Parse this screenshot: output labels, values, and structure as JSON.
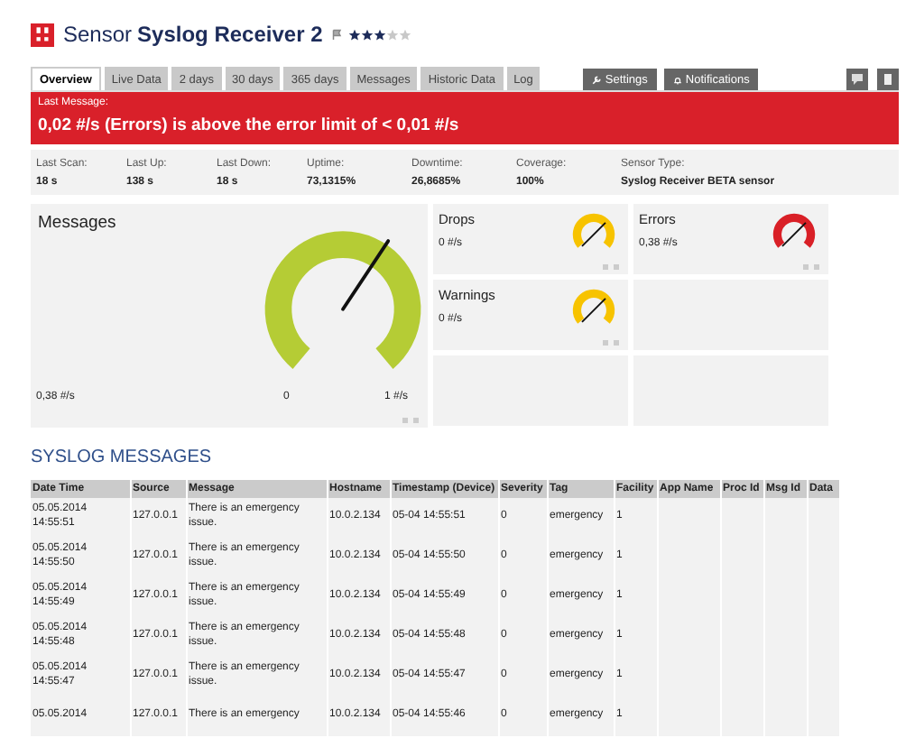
{
  "header": {
    "prefix": "Sensor",
    "title": "Syslog Receiver 2",
    "stars": 3
  },
  "tabs": [
    {
      "label": "Overview",
      "selected": true
    },
    {
      "label": "Live Data",
      "selected": false
    },
    {
      "label": "2 days",
      "selected": false
    },
    {
      "label": "30 days",
      "selected": false
    },
    {
      "label": "365 days",
      "selected": false
    },
    {
      "label": "Messages",
      "selected": false
    },
    {
      "label": "Historic Data",
      "selected": false
    },
    {
      "label": "Log",
      "selected": false
    }
  ],
  "actions": [
    {
      "label": "Settings",
      "kind": "settings"
    },
    {
      "label": "Notifications",
      "kind": "notifications"
    }
  ],
  "alert": {
    "label": "Last Message:",
    "message": "0,02 #/s (Errors) is above the error limit of < 0,01 #/s"
  },
  "stats": [
    {
      "label": "Last Scan:",
      "value": "18 s"
    },
    {
      "label": "Last Up:",
      "value": "138 s"
    },
    {
      "label": "Last Down:",
      "value": "18 s"
    },
    {
      "label": "Uptime:",
      "value": "73,1315%"
    },
    {
      "label": "Downtime:",
      "value": "26,8685%"
    },
    {
      "label": "Coverage:",
      "value": "100%"
    },
    {
      "label": "Sensor Type:",
      "value": "Syslog Receiver BETA sensor"
    }
  ],
  "main_gauge": {
    "title": "Messages",
    "value": "0,38 #/s",
    "min": "0",
    "max": "1 #/s",
    "level": 0.62,
    "color": "#b5cc35"
  },
  "small_gauges": [
    {
      "title": "Drops",
      "value": "0 #/s",
      "color": "#f7c300"
    },
    {
      "title": "Errors",
      "value": "0,38 #/s",
      "color": "#d92027"
    },
    {
      "title": "Warnings",
      "value": "0 #/s",
      "color": "#f7c300"
    }
  ],
  "syslog": {
    "title": "SYSLOG MESSAGES",
    "columns": [
      "Date Time",
      "Source",
      "Message",
      "Hostname",
      "Timestamp (Device)",
      "Severity",
      "Tag",
      "Facility",
      "App Name",
      "Proc Id",
      "Msg Id",
      "Data"
    ],
    "rows": [
      [
        "05.05.2014 14:55:51",
        "127.0.0.1",
        "There is an emergency issue.",
        "10.0.2.134",
        "05-04 14:55:51",
        "0",
        "emergency",
        "1"
      ],
      [
        "05.05.2014 14:55:50",
        "127.0.0.1",
        "There is an emergency issue.",
        "10.0.2.134",
        "05-04 14:55:50",
        "0",
        "emergency",
        "1"
      ],
      [
        "05.05.2014 14:55:49",
        "127.0.0.1",
        "There is an emergency issue.",
        "10.0.2.134",
        "05-04 14:55:49",
        "0",
        "emergency",
        "1"
      ],
      [
        "05.05.2014 14:55:48",
        "127.0.0.1",
        "There is an emergency issue.",
        "10.0.2.134",
        "05-04 14:55:48",
        "0",
        "emergency",
        "1"
      ],
      [
        "05.05.2014 14:55:47",
        "127.0.0.1",
        "There is an emergency issue.",
        "10.0.2.134",
        "05-04 14:55:47",
        "0",
        "emergency",
        "1"
      ],
      [
        "05.05.2014",
        "127.0.0.1",
        "There is an emergency",
        "10.0.2.134",
        "05-04 14:55:46",
        "0",
        "emergency",
        "1"
      ]
    ]
  }
}
